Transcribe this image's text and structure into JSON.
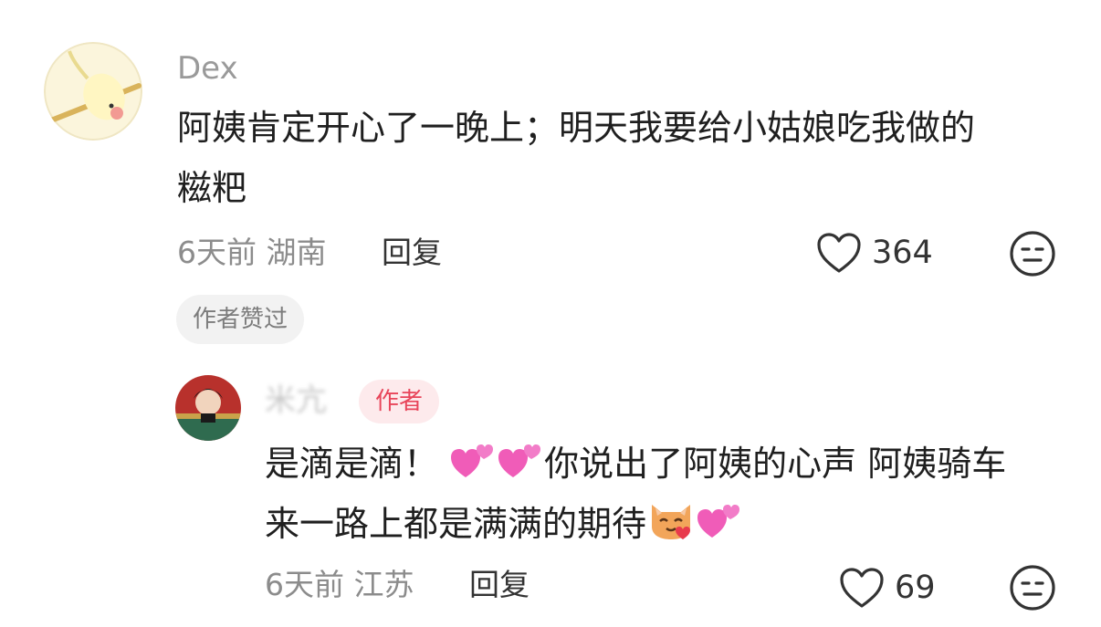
{
  "comment": {
    "username": "Dex",
    "text_lines": [
      "阿姨肯定开心了一晚上；明天我要给小姑娘吃我做的",
      "糍粑"
    ],
    "time_location": "6天前 湖南",
    "reply_label": "回复",
    "likes": "364",
    "liked_by_author_badge": "作者赞过"
  },
  "reply": {
    "username": "米亢",
    "author_badge": "作者",
    "text_line1_a": "是滴是滴！",
    "text_line1_b": "你说出了阿姨的心声 阿姨骑车",
    "text_line2": "来一路上都是满满的期待",
    "time_location": "6天前 江苏",
    "reply_label": "回复",
    "likes": "69"
  },
  "colors": {
    "accent_red": "#e8455a",
    "badge_bg": "#fdeaec",
    "muted_text": "#8c8c8c"
  },
  "icons": [
    "heart-outline-icon",
    "emoji-face-icon",
    "two-hearts-emoji",
    "cat-heart-emoji"
  ]
}
